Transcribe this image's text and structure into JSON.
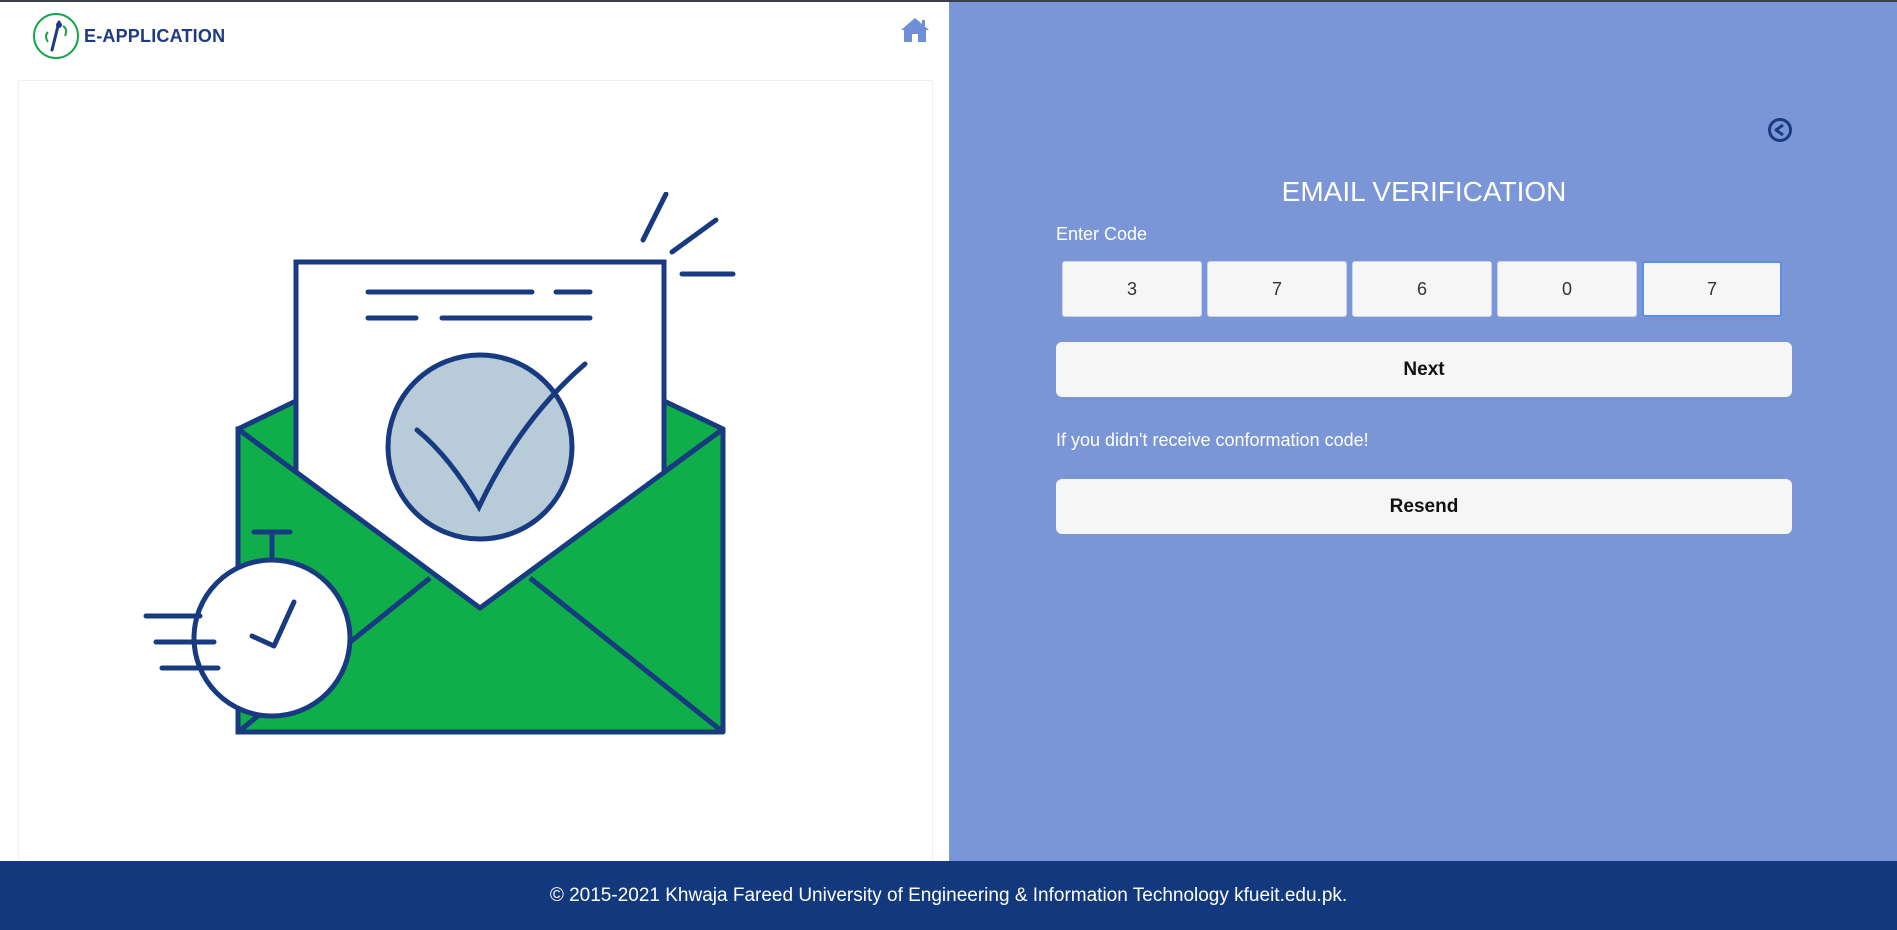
{
  "header": {
    "logo_text": "E-APPLICATION",
    "home_icon": "home-icon"
  },
  "verification": {
    "title": "EMAIL VERIFICATION",
    "enter_code_label": "Enter Code",
    "code_digits": [
      "3",
      "7",
      "6",
      "0",
      "7"
    ],
    "next_label": "Next",
    "hint_text": "If you didn't receive conformation code!",
    "resend_label": "Resend",
    "back_icon": "back-arrow-icon"
  },
  "footer": {
    "text": "© 2015-2021 Khwaja Fareed University of Engineering & Information Technology kfueit.edu.pk."
  },
  "colors": {
    "right_panel_bg": "#7b96d6",
    "footer_bg": "#12387e",
    "brand_navy": "#1e3a82",
    "envelope_green": "#0fae4b",
    "check_circle": "#b8cbd8"
  }
}
